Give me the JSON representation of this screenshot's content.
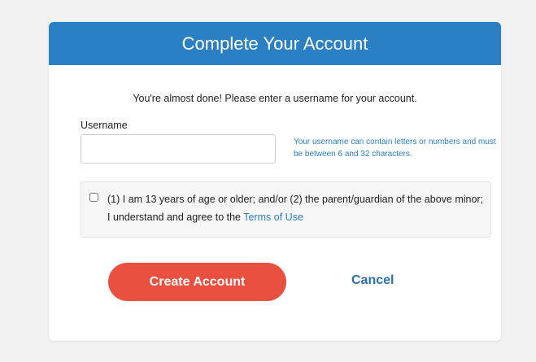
{
  "header": {
    "title": "Complete Your Account"
  },
  "form": {
    "intro_text": "You're almost done! Please enter a username for your account.",
    "username_label": "Username",
    "username_value": "",
    "username_placeholder": "",
    "username_hint": "Your username can contain letters or numbers and must be between 6 and 32 characters.",
    "terms_text": "(1) I am 13 years of age or older; and/or (2) the parent/guardian of the above minor; I understand and agree to the ",
    "terms_link": "Terms of Use",
    "terms_checked": false
  },
  "actions": {
    "create_label": "Create Account",
    "cancel_label": "Cancel"
  },
  "colors": {
    "header_bg": "#2b80c3",
    "primary_button": "#e9503f",
    "link": "#2b80c3"
  }
}
